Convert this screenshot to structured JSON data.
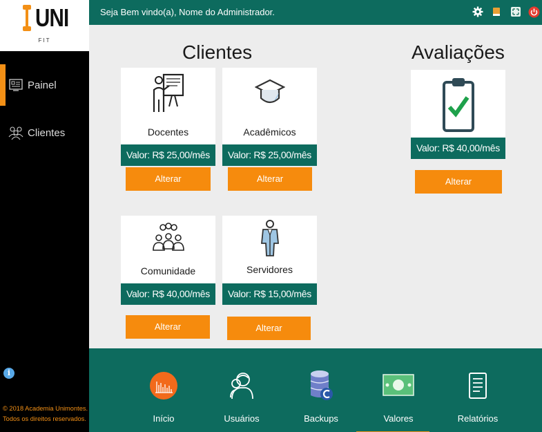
{
  "brand": {
    "logo_word": "UNI",
    "logo_sub": "FIT"
  },
  "header": {
    "welcome": "Seja Bem vindo(a), Nome do Administrador."
  },
  "sidebar": {
    "items": [
      {
        "label": "Painel",
        "icon": "dashboard-icon",
        "active": true
      },
      {
        "label": "Clientes",
        "icon": "clients-icon",
        "active": false
      }
    ],
    "copyright_line1": "© 2018 Academia Unimontes.",
    "copyright_line2": "Todos os direitos reservados."
  },
  "sections": {
    "clientes_title": "Clientes",
    "avaliacoes_title": "Avaliações"
  },
  "cards": {
    "docentes": {
      "name": "Docentes",
      "price": "Valor: R$ 25,00/mês",
      "button": "Alterar"
    },
    "academicos": {
      "name": "Acadêmicos",
      "price": "Valor: R$ 25,00/mês",
      "button": "Alterar"
    },
    "comunidade": {
      "name": "Comunidade",
      "price": "Valor: R$ 40,00/mês",
      "button": "Alterar"
    },
    "servidores": {
      "name": "Servidores",
      "price": "Valor: R$ 15,00/mês",
      "button": "Alterar"
    },
    "avaliacoes": {
      "name": "",
      "price": "Valor: R$ 40,00/mês",
      "button": "Alterar"
    }
  },
  "dock": {
    "items": [
      {
        "label": "Início",
        "icon": "home-chart-icon"
      },
      {
        "label": "Usuários",
        "icon": "users-icon"
      },
      {
        "label": "Backups",
        "icon": "database-icon"
      },
      {
        "label": "Valores",
        "icon": "money-icon",
        "active": true
      },
      {
        "label": "Relatórios",
        "icon": "report-icon"
      }
    ]
  },
  "colors": {
    "primary": "#0d6b5e",
    "accent": "#f68b0d",
    "sidebar": "#000000",
    "background": "#ededed"
  }
}
